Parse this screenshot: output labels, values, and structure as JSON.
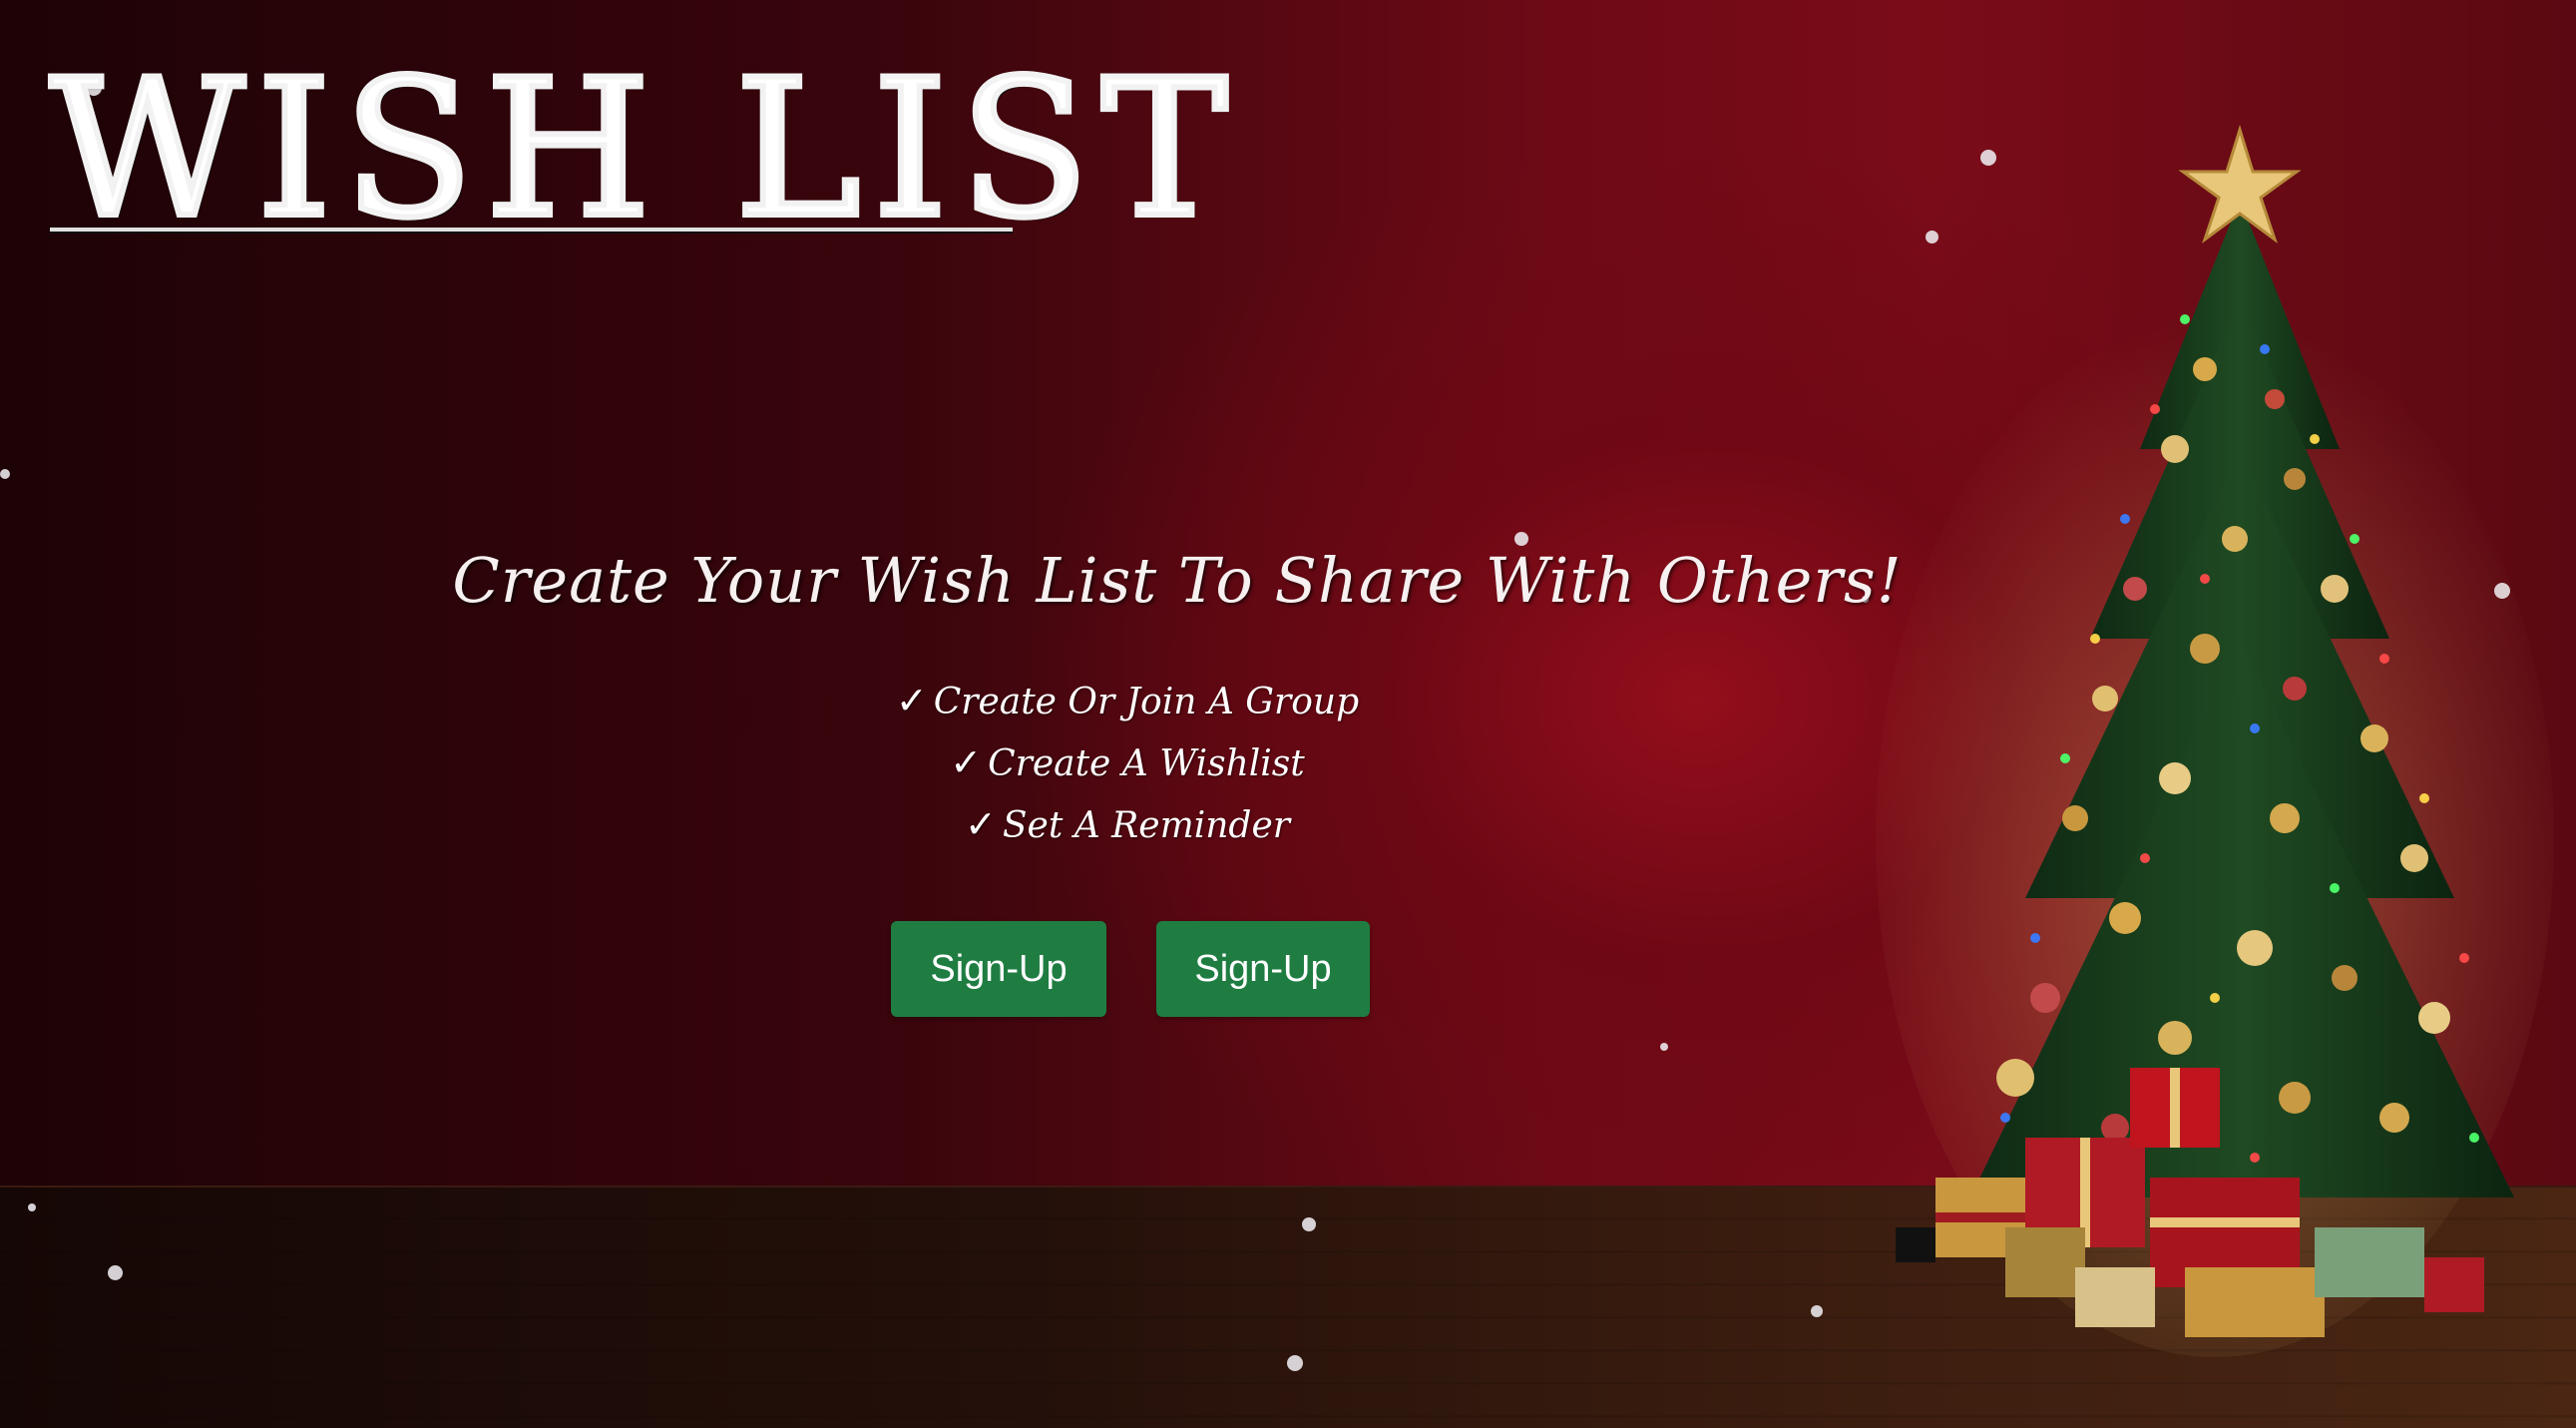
{
  "app": {
    "logo_text": "WISH LIST"
  },
  "hero": {
    "headline": "Create Your Wish List To Share With Others!",
    "check_glyph": "✓",
    "features": [
      "Create Or Join A Group",
      "Create A Wishlist",
      "Set A Reminder"
    ]
  },
  "actions": {
    "primary_label": "Sign-Up",
    "secondary_label": "Sign-Up"
  },
  "colors": {
    "button": "#1f7d42",
    "background_wall": "#6d0a16",
    "text": "#ffffff"
  },
  "decor": {
    "tree_icon": "christmas-tree",
    "star_icon": "star",
    "gift_icon": "gift-box",
    "snow_icon": "snowflake"
  }
}
